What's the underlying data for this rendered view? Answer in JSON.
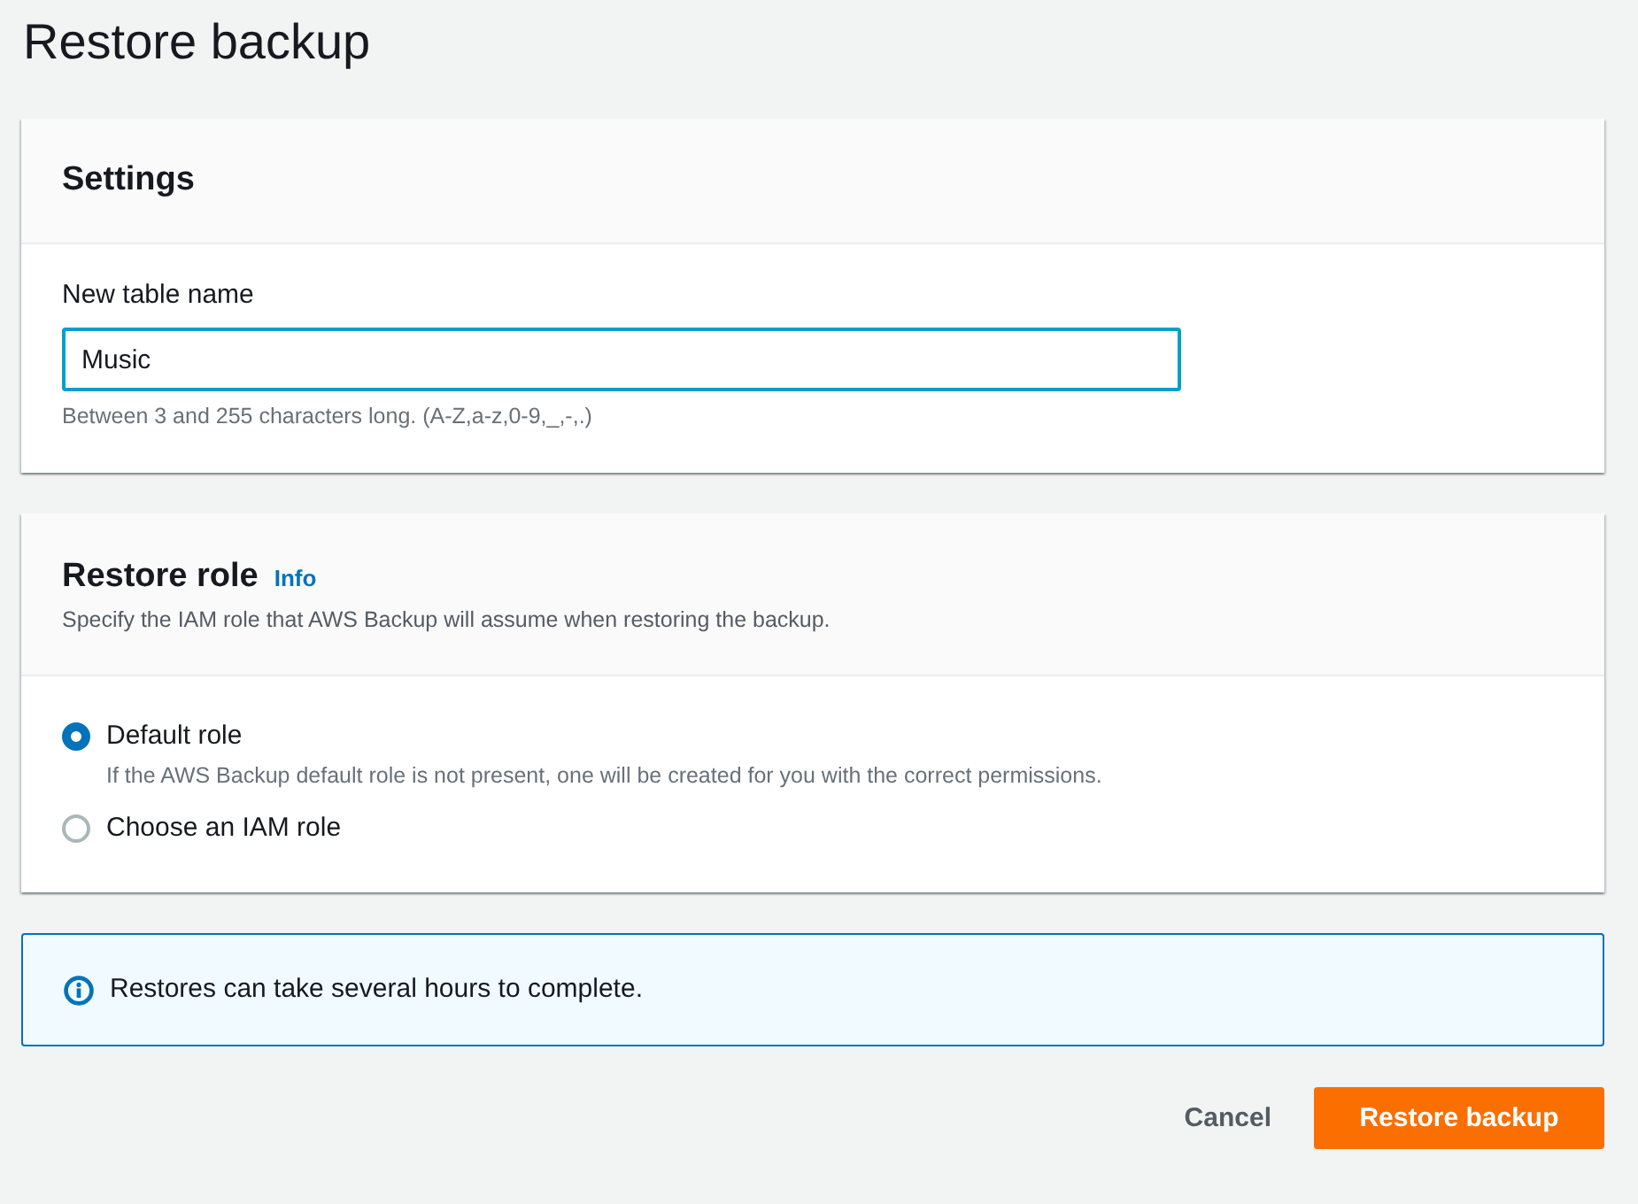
{
  "page": {
    "title": "Restore backup"
  },
  "settings": {
    "title": "Settings",
    "field": {
      "label": "New table name",
      "value": "Music",
      "focused": true,
      "hint": "Between 3 and 255 characters long. (A-Z,a-z,0-9,_,-,.)"
    }
  },
  "restore_role": {
    "title": "Restore role",
    "info_link": "Info",
    "description": "Specify the IAM role that AWS Backup will assume when restoring the backup.",
    "options": [
      {
        "label": "Default role",
        "description": "If the AWS Backup default role is not present, one will be created for you with the correct permissions.",
        "selected": true
      },
      {
        "label": "Choose an IAM role",
        "selected": false
      }
    ]
  },
  "alert": {
    "kind": "info",
    "message": "Restores can take several hours to complete."
  },
  "actions": {
    "cancel": "Cancel",
    "primary": "Restore backup"
  }
}
